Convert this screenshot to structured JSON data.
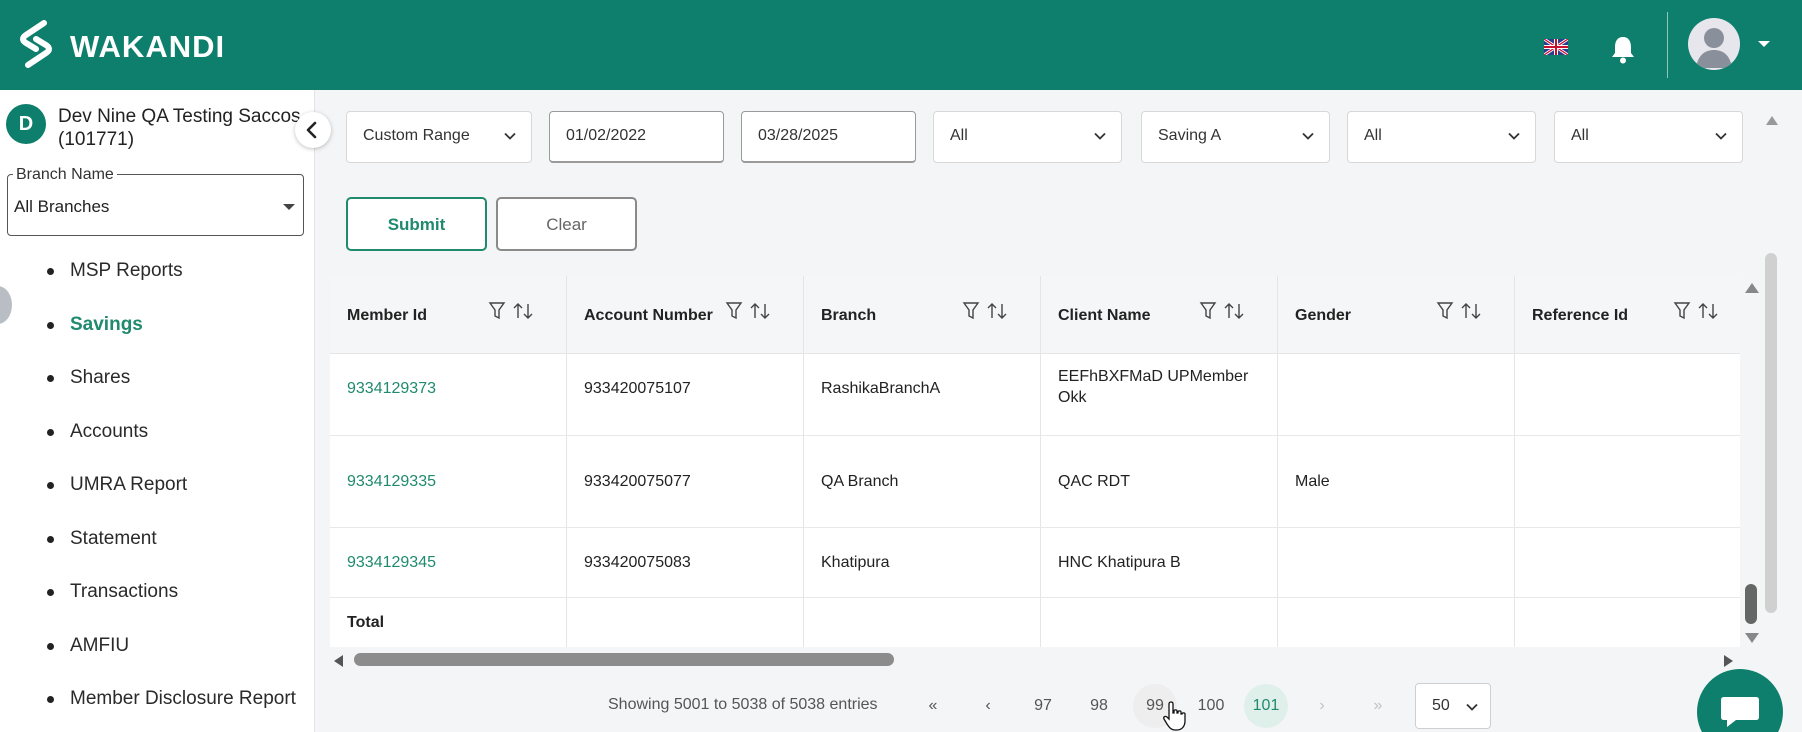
{
  "header": {
    "brand": "WAKANDI",
    "icons": [
      "logo-icon",
      "flag-uk-icon",
      "bell-icon",
      "user-avatar-icon",
      "caret-down-icon"
    ]
  },
  "sidebar": {
    "org_initial": "D",
    "org_name_line1": "Dev Nine QA Testing Saccos",
    "org_name_line2": "(101771)",
    "branch_label": "Branch Name",
    "branch_value": "All Branches",
    "menu": [
      {
        "label": "MSP Reports",
        "active": false
      },
      {
        "label": "Savings",
        "active": true
      },
      {
        "label": "Shares",
        "active": false
      },
      {
        "label": "Accounts",
        "active": false
      },
      {
        "label": "UMRA Report",
        "active": false
      },
      {
        "label": "Statement",
        "active": false
      },
      {
        "label": "Transactions",
        "active": false
      },
      {
        "label": "AMFIU",
        "active": false
      },
      {
        "label": "Member Disclosure Report",
        "active": false
      }
    ]
  },
  "filters": {
    "range": "Custom Range",
    "from_date": "01/02/2022",
    "to_date": "03/28/2025",
    "filter3": "All",
    "product": "Saving A",
    "filter5": "All",
    "filter6": "All",
    "submit": "Submit",
    "clear": "Clear"
  },
  "table": {
    "columns": [
      "Member Id",
      "Account Number",
      "Branch",
      "Client Name",
      "Gender",
      "Reference Id"
    ],
    "rows": [
      {
        "member_id": "9334129373",
        "account": "933420075107",
        "branch": "RashikaBranchA",
        "client_l1": "EEFhBXFMaD UPMember",
        "client_l2": "Okk",
        "gender": "",
        "ref": ""
      },
      {
        "member_id": "9334129335",
        "account": "933420075077",
        "branch": "QA Branch",
        "client_l1": "QAC RDT",
        "client_l2": "",
        "gender": "Male",
        "ref": ""
      },
      {
        "member_id": "9334129345",
        "account": "933420075083",
        "branch": "Khatipura",
        "client_l1": "HNC Khatipura B",
        "client_l2": "",
        "gender": "",
        "ref": ""
      }
    ],
    "total_label": "Total"
  },
  "pagination": {
    "showing": "Showing 5001 to 5038 of 5038 entries",
    "first": "«",
    "prev": "‹",
    "pages": [
      "97",
      "98",
      "99",
      "100",
      "101"
    ],
    "current": "101",
    "next": "›",
    "last": "»",
    "page_size": "50"
  },
  "colors": {
    "brand": "#0e7f6c",
    "link": "#1f8a6e",
    "current_page_bg": "#dff0ea"
  }
}
